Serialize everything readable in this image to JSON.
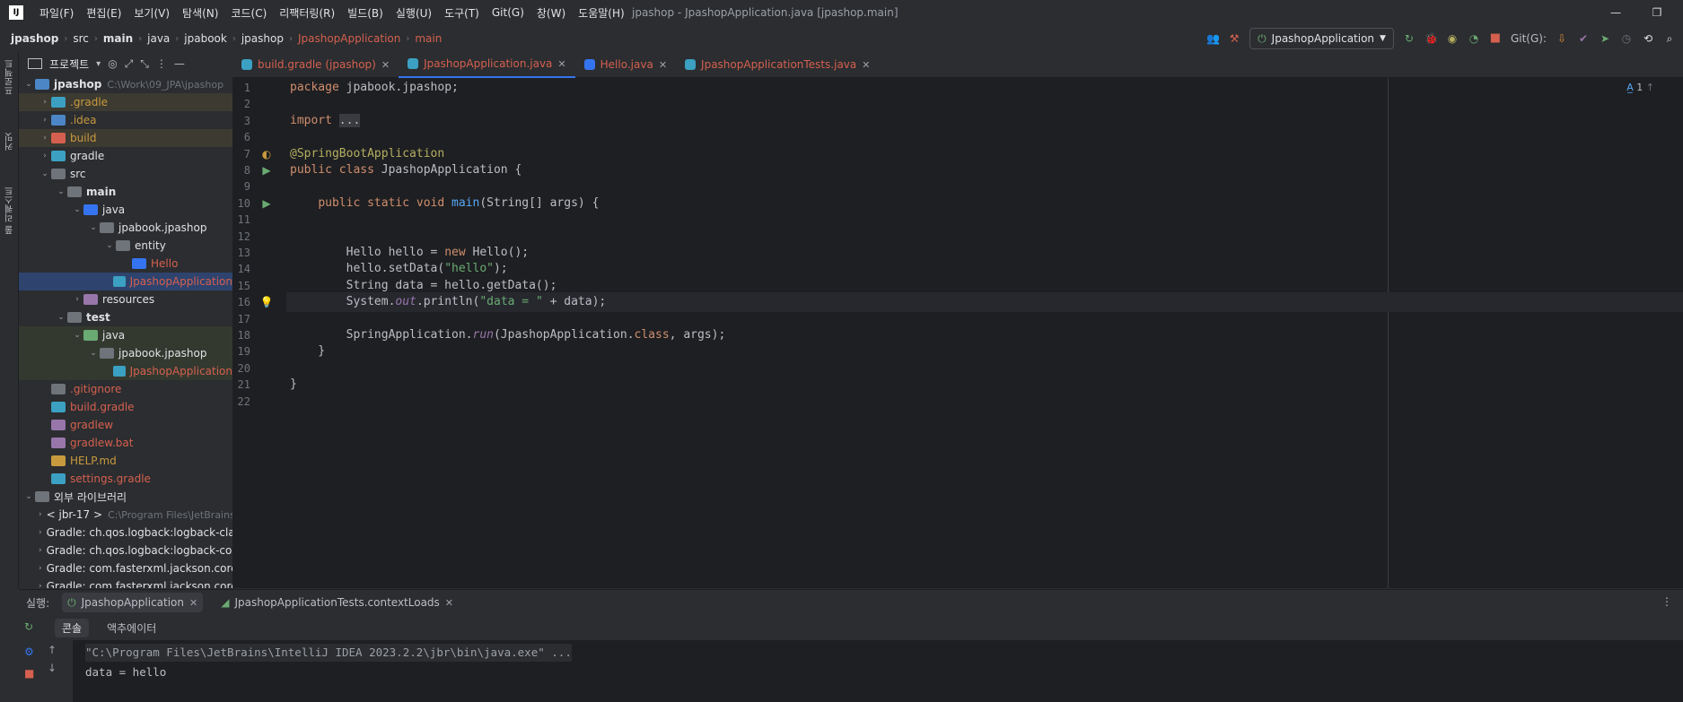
{
  "menubar": {
    "items": [
      "파일(F)",
      "편집(E)",
      "보기(V)",
      "탐색(N)",
      "코드(C)",
      "리팩터링(R)",
      "빌드(B)",
      "실행(U)",
      "도구(T)",
      "Git(G)",
      "창(W)",
      "도움말(H)"
    ],
    "window_title": "jpashop - JpashopApplication.java [jpashop.main]"
  },
  "breadcrumbs": [
    "jpashop",
    "src",
    "main",
    "java",
    "jpabook",
    "jpashop",
    "JpashopApplication",
    "main"
  ],
  "toolbar": {
    "run_config": "JpashopApplication",
    "git_label": "Git(G):"
  },
  "left_strip": {
    "project": "프로젝트",
    "commit": "커밋",
    "pull": "풀 리퀘스트"
  },
  "project": {
    "title": "프로젝트",
    "tree": [
      {
        "label": "jpashop",
        "path": "C:\\Work\\09_JPA\\jpashop",
        "depth": 0,
        "open": "open",
        "color": "#dfe1e5",
        "bold": true,
        "icon": "#4c86c6"
      },
      {
        "label": ".gradle",
        "depth": 1,
        "open": "closed",
        "color": "#c89a3e",
        "icon": "#3ba0c2",
        "hl": "hl-orange"
      },
      {
        "label": ".idea",
        "depth": 1,
        "open": "closed",
        "color": "#c89a3e",
        "icon": "#4c86c6"
      },
      {
        "label": "build",
        "depth": 1,
        "open": "closed",
        "color": "#c89a3e",
        "icon": "#d5604f",
        "hl": "hl-orange"
      },
      {
        "label": "gradle",
        "depth": 1,
        "open": "closed",
        "color": "#dfe1e5",
        "icon": "#3ba0c2"
      },
      {
        "label": "src",
        "depth": 1,
        "open": "open",
        "color": "#dfe1e5",
        "icon": "#6f737a"
      },
      {
        "label": "main",
        "depth": 2,
        "open": "open",
        "color": "#dfe1e5",
        "bold": true,
        "icon": "#6f737a"
      },
      {
        "label": "java",
        "depth": 3,
        "open": "open",
        "color": "#dfe1e5",
        "icon": "#3574f0"
      },
      {
        "label": "jpabook.jpashop",
        "depth": 4,
        "open": "open",
        "color": "#dfe1e5",
        "icon": "#6f737a"
      },
      {
        "label": "entity",
        "depth": 5,
        "open": "open",
        "color": "#dfe1e5",
        "icon": "#6f737a"
      },
      {
        "label": "Hello",
        "depth": 6,
        "open": "none",
        "color": "#d5604f",
        "icon": "#3574f0"
      },
      {
        "label": "JpashopApplication",
        "depth": 5,
        "open": "none",
        "color": "#d5604f",
        "icon": "#3ba0c2",
        "hl": "hl-sel"
      },
      {
        "label": "resources",
        "depth": 3,
        "open": "closed",
        "color": "#dfe1e5",
        "icon": "#9876aa"
      },
      {
        "label": "test",
        "depth": 2,
        "open": "open",
        "color": "#dfe1e5",
        "bold": true,
        "icon": "#6f737a"
      },
      {
        "label": "java",
        "depth": 3,
        "open": "open",
        "color": "#dfe1e5",
        "icon": "#6aab73",
        "hl": "hl-green"
      },
      {
        "label": "jpabook.jpashop",
        "depth": 4,
        "open": "open",
        "color": "#dfe1e5",
        "icon": "#6f737a",
        "hl": "hl-green"
      },
      {
        "label": "JpashopApplication",
        "depth": 5,
        "open": "none",
        "color": "#d5604f",
        "icon": "#3ba0c2",
        "hl": "hl-green"
      },
      {
        "label": ".gitignore",
        "depth": 1,
        "open": "none",
        "color": "#d5604f",
        "icon": "#6f737a"
      },
      {
        "label": "build.gradle",
        "depth": 1,
        "open": "none",
        "color": "#d5604f",
        "icon": "#3ba0c2"
      },
      {
        "label": "gradlew",
        "depth": 1,
        "open": "none",
        "color": "#d5604f",
        "icon": "#9876aa"
      },
      {
        "label": "gradlew.bat",
        "depth": 1,
        "open": "none",
        "color": "#d5604f",
        "icon": "#9876aa"
      },
      {
        "label": "HELP.md",
        "depth": 1,
        "open": "none",
        "color": "#c89a3e",
        "icon": "#c89a3e"
      },
      {
        "label": "settings.gradle",
        "depth": 1,
        "open": "none",
        "color": "#d5604f",
        "icon": "#3ba0c2"
      },
      {
        "label": "외부 라이브러리",
        "depth": 0,
        "open": "open",
        "color": "#dfe1e5",
        "icon": "#6f737a"
      },
      {
        "label": "< jbr-17 >",
        "path": "C:\\Program Files\\JetBrains",
        "depth": 1,
        "open": "closed",
        "color": "#dfe1e5",
        "icon": "#6f737a"
      },
      {
        "label": "Gradle: ch.qos.logback:logback-classic",
        "depth": 1,
        "open": "closed",
        "color": "#dfe1e5",
        "icon": "#6f737a"
      },
      {
        "label": "Gradle: ch.qos.logback:logback-core",
        "depth": 1,
        "open": "closed",
        "color": "#dfe1e5",
        "icon": "#6f737a"
      },
      {
        "label": "Gradle: com.fasterxml.jackson.core",
        "depth": 1,
        "open": "closed",
        "color": "#dfe1e5",
        "icon": "#6f737a"
      },
      {
        "label": "Gradle: com.fasterxml.jackson.core",
        "depth": 1,
        "open": "closed",
        "color": "#dfe1e5",
        "icon": "#6f737a"
      }
    ]
  },
  "tabs": [
    {
      "label": "build.gradle (jpashop)",
      "color": "#d5604f",
      "icon": "#3ba0c2",
      "active": false
    },
    {
      "label": "JpashopApplication.java",
      "color": "#d5604f",
      "icon": "#3ba0c2",
      "active": true
    },
    {
      "label": "Hello.java",
      "color": "#d5604f",
      "icon": "#3574f0",
      "active": false
    },
    {
      "label": "JpashopApplicationTests.java",
      "color": "#d5604f",
      "icon": "#3ba0c2",
      "active": false
    }
  ],
  "editor": {
    "inspection_count": "1",
    "line_numbers": [
      "1",
      "2",
      "3",
      "6",
      "7",
      "8",
      "9",
      "10",
      "11",
      "12",
      "13",
      "14",
      "15",
      "16",
      "17",
      "18",
      "19",
      "20",
      "21",
      "22"
    ],
    "code": [
      "<span class=\"kw\">package</span> jpabook.jpashop;",
      "",
      "<span class=\"kw\">import</span> <span style=\"background:#393b40\">...</span>",
      "",
      "<span class=\"ann\">@SpringBootApplication</span>",
      "<span class=\"kw\">public class</span> JpashopApplication {",
      "",
      "    <span class=\"kw\">public static void</span> <span class=\"fn\">main</span>(String[] args) {",
      "",
      "",
      "        Hello hello = <span class=\"kw\">new</span> Hello();",
      "        hello.setData(<span class=\"str\">\"hello\"</span>);",
      "        String data = hello.getData();",
      "        System.<span class=\"st\">out</span>.println(<span class=\"str\">\"data = \"</span> + data);",
      "",
      "        SpringApplication.<span class=\"st\">run</span>(JpashopApplication.<span class=\"kw\">class</span>, args);",
      "    }",
      "",
      "}",
      ""
    ]
  },
  "run_panel": {
    "label": "실행:",
    "tabs": [
      "JpashopApplication",
      "JpashopApplicationTests.contextLoads"
    ],
    "console_tabs": [
      "콘솔",
      "액추에이터"
    ],
    "console_lines": [
      "\"C:\\Program Files\\JetBrains\\IntelliJ IDEA 2023.2.2\\jbr\\bin\\java.exe\" ...",
      "data = hello"
    ]
  }
}
